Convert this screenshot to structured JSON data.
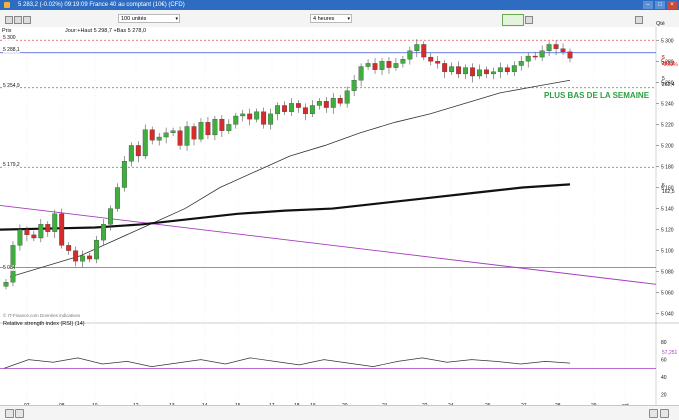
{
  "window": {
    "title": "5 283,2 (-0.02%) 09:19:09 France 40 au comptant (10€) (CFD)",
    "buttons": [
      "–",
      "□",
      "×"
    ]
  },
  "toolbar": {
    "size_select": "100 unités",
    "period_select": "4 heures",
    "qte_label": "Qté"
  },
  "chart": {
    "price_label": "Prix",
    "info": "Jour:+Haut 5 298,7 +Bas 5 278,0",
    "annotation": "PLUS BAS DE LA SEMAINE",
    "watermark": "© IT-Finance.com Données indicatives",
    "rsi_title": "Relative strength index (RSI) (14)",
    "level_labels": [
      "5 300",
      "5 288,1",
      "5 254,9",
      "5 179,2",
      "5 084"
    ],
    "price_tags": [
      "5 283,2",
      "-0,02%",
      "5 262,4",
      "5 162,5"
    ],
    "rsi_value": "57,251"
  },
  "chart_data": {
    "type": "candlestick",
    "x_ticks": [
      "07",
      "08",
      "10",
      "12",
      "13",
      "14",
      "15",
      "17",
      "18",
      "19",
      "20",
      "21",
      "22",
      "24",
      "26",
      "27",
      "28",
      "29",
      "oct."
    ],
    "y_ticks": [
      5300,
      5280,
      5260,
      5240,
      5220,
      5200,
      5180,
      5160,
      5140,
      5120,
      5100,
      5080,
      5060,
      5040
    ],
    "ylim": [
      5035,
      5305
    ],
    "rsi_ticks": [
      80,
      60,
      40,
      20
    ],
    "rsi_ylim": [
      15,
      95
    ],
    "series": [
      {
        "name": "Prix",
        "values": [
          5070,
          5105,
          5120,
          5115,
          5112,
          5125,
          5118,
          5135,
          5105,
          5100,
          5090,
          5095,
          5092,
          5110,
          5125,
          5140,
          5160,
          5185,
          5200,
          5190,
          5215,
          5205,
          5208,
          5212,
          5214,
          5200,
          5218,
          5206,
          5222,
          5210,
          5225,
          5214,
          5220,
          5228,
          5230,
          5225,
          5232,
          5220,
          5230,
          5238,
          5232,
          5240,
          5236,
          5230,
          5238,
          5242,
          5236,
          5245,
          5240,
          5252,
          5262,
          5275,
          5278,
          5272,
          5280,
          5274,
          5278,
          5282,
          5290,
          5296,
          5284,
          5280,
          5278,
          5270,
          5275,
          5268,
          5274,
          5266,
          5272,
          5268,
          5270,
          5274,
          5270,
          5276,
          5280,
          5285,
          5284,
          5290,
          5296,
          5292,
          5289,
          5283
        ]
      },
      {
        "name": "Moyenne mobile 1",
        "values": [
          5075,
          5085,
          5095,
          5110,
          5125,
          5140,
          5160,
          5175,
          5190,
          5200,
          5212,
          5222,
          5230,
          5240,
          5250,
          5256,
          5262
        ]
      },
      {
        "name": "Moyenne mobile 2",
        "values": [
          5120,
          5121,
          5122,
          5125,
          5130,
          5135,
          5138,
          5140,
          5145,
          5150,
          5155,
          5160,
          5163
        ]
      },
      {
        "name": "Droite de tendance",
        "values": [
          5143,
          5068
        ]
      },
      {
        "name": "RSI",
        "values": [
          50,
          60,
          57,
          62,
          55,
          58,
          52,
          56,
          60,
          55,
          62,
          58,
          54,
          60,
          56,
          52,
          58,
          62,
          57,
          60,
          58,
          55,
          58,
          56
        ]
      }
    ],
    "levels": [
      {
        "label": "5 300",
        "value": 5300
      },
      {
        "label": "5 288,1",
        "value": 5288.1
      },
      {
        "label": "5 254,9",
        "value": 5254.9
      },
      {
        "label": "5 179,2",
        "value": 5179.2
      },
      {
        "label": "5 084",
        "value": 5084
      }
    ],
    "rsi_reference": 50
  },
  "colors": {
    "up": "#3fae3f",
    "down": "#d62b2b",
    "level_blue": "#3a4fd4",
    "level_green": "#5aa84f",
    "resistance_red": "#e05050",
    "trendline": "#a63bbf",
    "ma_thick": "#111111",
    "ma_thin": "#333333",
    "title_bar": "#2d6cc0",
    "annotation": "#2ea043"
  }
}
